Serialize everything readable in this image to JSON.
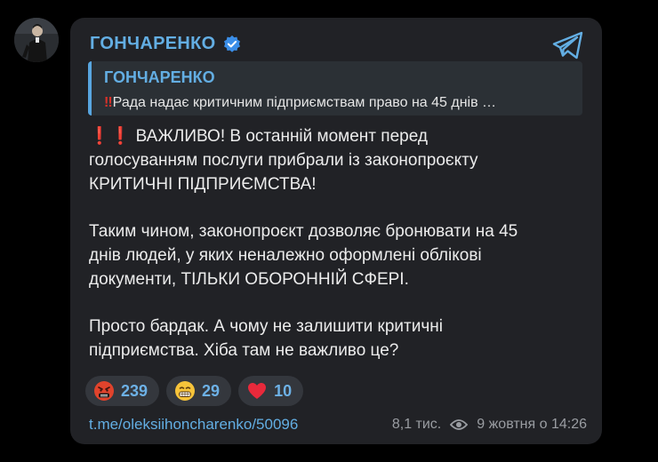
{
  "channel": {
    "name": "ГОНЧАРЕНКО",
    "verified_icon": "verified-badge-icon",
    "logo_icon": "telegram-plane-icon"
  },
  "reply": {
    "author": "ГОНЧАРЕНКО",
    "text": "Рада надає критичним підприємствам право на 45 днів …",
    "mark_icon": "double-exclamation-icon"
  },
  "message": {
    "paragraph1": "ВАЖЛИВО! В останній момент перед\nголосуванням послуги прибрали із законопроєкту\nКРИТИЧНІ ПІДПРИЄМСТВА!",
    "paragraph2": "Таким чином, законопроєкт дозволяє бронювати на 45\nднів людей, у яких неналежно оформлені облікові\nдокументи, ТІЛЬКИ ОБОРОННІЙ СФЕРІ.",
    "paragraph3": "Просто бардак. А чому не залишити критичні\nпідприємства. Хіба там не важливо це?",
    "alarm": "❗❗"
  },
  "reactions": [
    {
      "icon": "angry-face-icon",
      "count": "239"
    },
    {
      "icon": "grimacing-face-icon",
      "count": "29"
    },
    {
      "icon": "red-heart-icon",
      "count": "10"
    }
  ],
  "footer": {
    "link": "t.me/oleksiihoncharenko/50096",
    "views": "8,1 тис.",
    "date": "9 жовтня о 14:26"
  },
  "colors": {
    "background": "#000000",
    "card": "#212226",
    "accent": "#63aee3",
    "text": "#ececec",
    "muted": "#9a9da2",
    "alarm": "#d9322a"
  }
}
